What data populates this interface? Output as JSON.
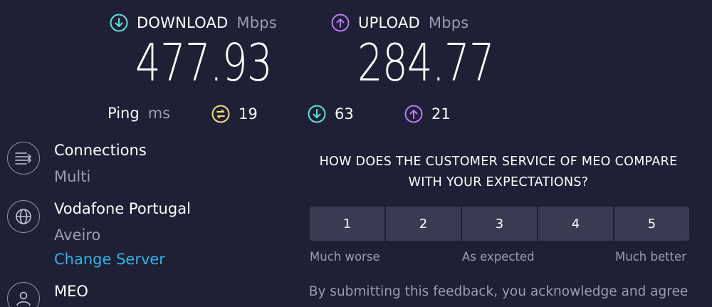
{
  "download": {
    "label": "DOWNLOAD",
    "unit": "Mbps",
    "value": "477.93",
    "color": "#5ce1d8",
    "icon": "download-arrow-icon"
  },
  "upload": {
    "label": "UPLOAD",
    "unit": "Mbps",
    "value": "284.77",
    "color": "#b97cf0",
    "icon": "upload-arrow-icon"
  },
  "ping": {
    "label": "Ping",
    "unit": "ms",
    "idle": "19",
    "download": "63",
    "upload": "21",
    "idle_color": "#f2de78"
  },
  "connections": {
    "title": "Connections",
    "value": "Multi"
  },
  "server": {
    "name": "Vodafone Portugal",
    "location": "Aveiro",
    "change_link": "Change Server"
  },
  "provider": {
    "name": "MEO"
  },
  "survey": {
    "question_line1": "HOW DOES THE CUSTOMER SERVICE OF MEO COMPARE",
    "question_line2": "WITH YOUR EXPECTATIONS?",
    "options": [
      "1",
      "2",
      "3",
      "4",
      "5"
    ],
    "scale_low": "Much worse",
    "scale_mid": "As expected",
    "scale_high": "Much better",
    "disclaimer": "By submitting this feedback, you acknowledge and agree"
  },
  "colors": {
    "background": "#1f1f35",
    "link": "#2fb4e6",
    "muted": "#9c9db0"
  }
}
